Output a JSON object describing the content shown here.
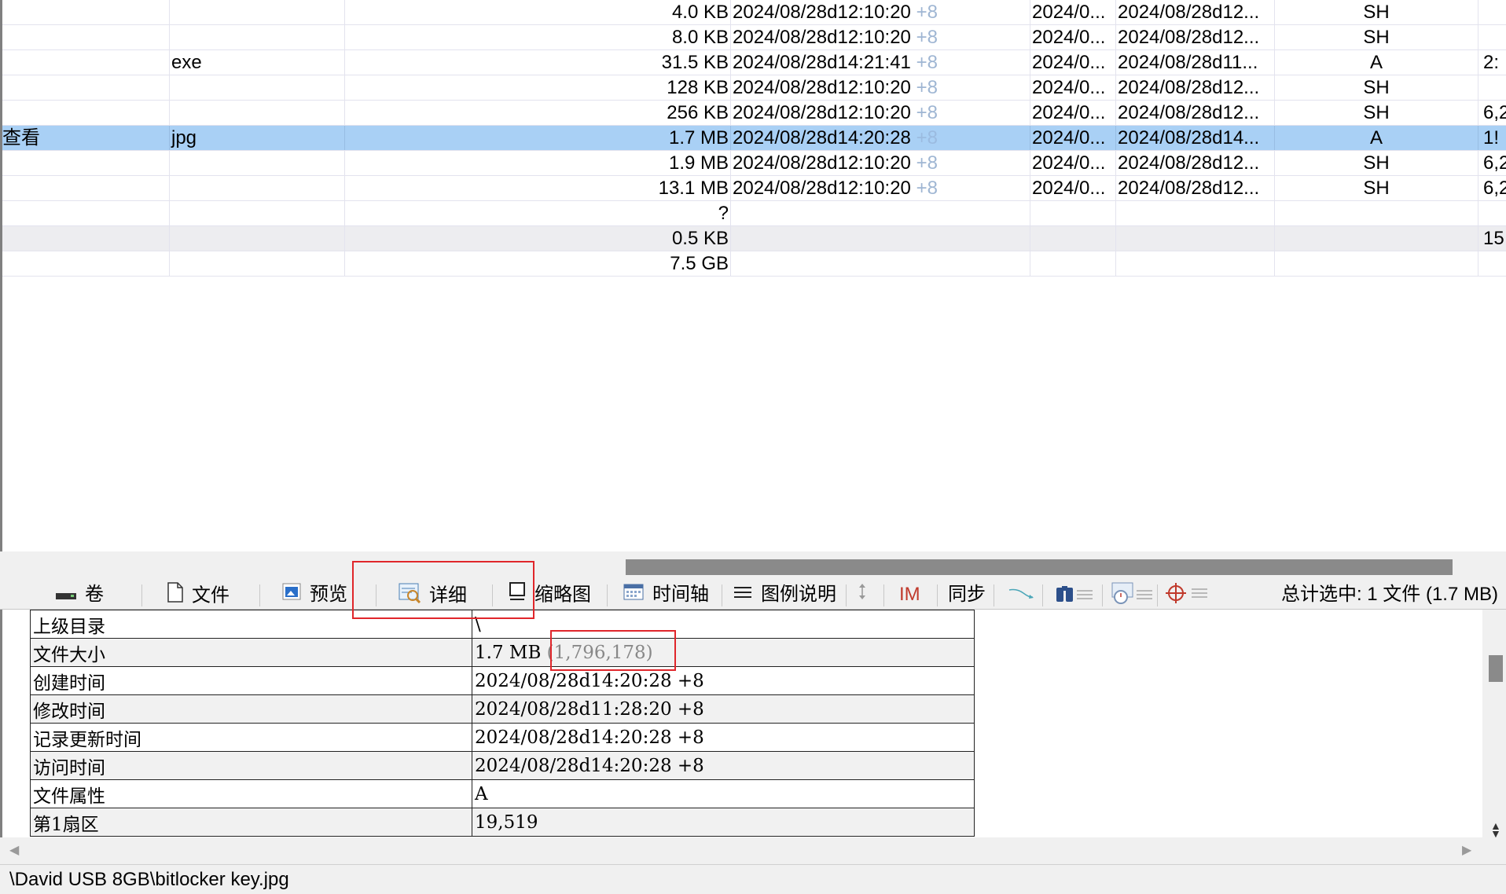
{
  "table": {
    "rows": [
      {
        "name": "",
        "ext": "",
        "size": "4.0 KB",
        "created": "2024/08/28d12:10:20",
        "tz": "+8",
        "modified": "2024/0...",
        "accessed": "2024/08/28d12...",
        "attr": "SH",
        "sector": "",
        "style": ""
      },
      {
        "name": "",
        "ext": "",
        "size": "8.0 KB",
        "created": "2024/08/28d12:10:20",
        "tz": "+8",
        "modified": "2024/0...",
        "accessed": "2024/08/28d12...",
        "attr": "SH",
        "sector": "",
        "style": ""
      },
      {
        "name": "",
        "ext": "exe",
        "size": "31.5 KB",
        "created": "2024/08/28d14:21:41",
        "tz": "+8",
        "modified": "2024/0...",
        "accessed": "2024/08/28d11...",
        "attr": "A",
        "sector": "2:",
        "style": ""
      },
      {
        "name": "",
        "ext": "",
        "size": "128 KB",
        "created": "2024/08/28d12:10:20",
        "tz": "+8",
        "modified": "2024/0...",
        "accessed": "2024/08/28d12...",
        "attr": "SH",
        "sector": "",
        "style": ""
      },
      {
        "name": "",
        "ext": "",
        "size": "256 KB",
        "created": "2024/08/28d12:10:20",
        "tz": "+8",
        "modified": "2024/0...",
        "accessed": "2024/08/28d12...",
        "attr": "SH",
        "sector": "6,2",
        "style": ""
      },
      {
        "name": "查看",
        "ext": "jpg",
        "size": "1.7 MB",
        "created": "2024/08/28d14:20:28",
        "tz": "+8",
        "modified": "2024/0...",
        "accessed": "2024/08/28d14...",
        "attr": "A",
        "sector": "1!",
        "style": "selected"
      },
      {
        "name": "",
        "ext": "",
        "size": "1.9 MB",
        "created": "2024/08/28d12:10:20",
        "tz": "+8",
        "modified": "2024/0...",
        "accessed": "2024/08/28d12...",
        "attr": "SH",
        "sector": "6,2",
        "style": ""
      },
      {
        "name": "",
        "ext": "",
        "size": "13.1 MB",
        "created": "2024/08/28d12:10:20",
        "tz": "+8",
        "modified": "2024/0...",
        "accessed": "2024/08/28d12...",
        "attr": "SH",
        "sector": "6,2",
        "style": ""
      },
      {
        "name": "",
        "ext": "",
        "size": "?",
        "created": "",
        "tz": "",
        "modified": "",
        "accessed": "",
        "attr": "",
        "sector": "",
        "style": ""
      },
      {
        "name": "",
        "ext": "",
        "size": "0.5 KB",
        "created": "",
        "tz": "",
        "modified": "",
        "accessed": "",
        "attr": "",
        "sector": "15",
        "style": "shaded"
      },
      {
        "name": "",
        "ext": "",
        "size": "7.5 GB",
        "created": "",
        "tz": "",
        "modified": "",
        "accessed": "",
        "attr": "",
        "sector": "",
        "style": ""
      }
    ]
  },
  "tabs": {
    "volume": "卷",
    "file": "文件",
    "preview": "预览",
    "details": "详细",
    "thumbnail": "缩略图",
    "timeline": "时间轴",
    "legend": "图例说明",
    "im": "IM",
    "sync": "同步"
  },
  "summary": "总计选中: 1 文件 (1.7 MB)",
  "details": {
    "rows": [
      {
        "key": "上级目录",
        "value": "\\",
        "extra": ""
      },
      {
        "key": "文件大小",
        "value": "1.7 MB ",
        "extra": "(1,796,178)"
      },
      {
        "key": "创建时间",
        "value": "2024/08/28d14:20:28 +8",
        "extra": ""
      },
      {
        "key": "修改时间",
        "value": "2024/08/28d11:28:20 +8",
        "extra": ""
      },
      {
        "key": "记录更新时间",
        "value": "2024/08/28d14:20:28 +8",
        "extra": ""
      },
      {
        "key": "访问时间",
        "value": "2024/08/28d14:20:28 +8",
        "extra": ""
      },
      {
        "key": "文件属性",
        "value": "A",
        "extra": ""
      },
      {
        "key": "第1扇区",
        "value": "19,519",
        "extra": ""
      }
    ]
  },
  "status": {
    "path": "\\David USB 8GB\\bitlocker key.jpg"
  },
  "colors": {
    "selection": "#a9d0f5",
    "highlight_box": "#e0262b",
    "im_text": "#c0392b"
  },
  "icons": [
    "drive-icon",
    "file-icon",
    "preview-icon",
    "details-icon",
    "thumbnail-icon",
    "calendar-icon",
    "list-icon",
    "updown-arrow-icon",
    "sync-arrow-icon",
    "binoculars-icon",
    "clock-icon",
    "crosshair-icon"
  ]
}
